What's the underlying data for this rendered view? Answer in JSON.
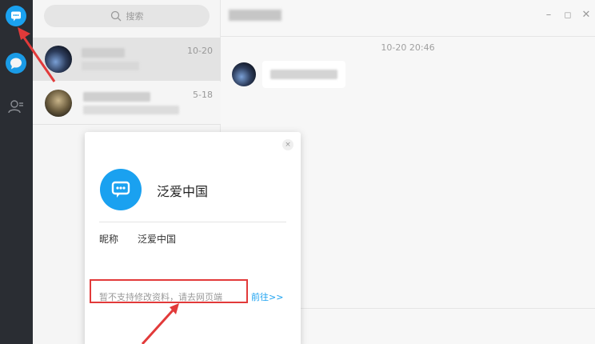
{
  "search": {
    "placeholder": "搜索"
  },
  "conversations": [
    {
      "time": "10-20"
    },
    {
      "time": "5-18"
    }
  ],
  "chat": {
    "timestamp": "10-20 20:46"
  },
  "window_controls": {
    "minimize": "–",
    "maximize": "◻",
    "close": "✕"
  },
  "profile_card": {
    "name": "泛爱中国",
    "nickname_label": "昵称",
    "nickname_value": "泛爱中国",
    "notice": "暂不支持修改资料，请去网页端",
    "link": "前往>>",
    "close": "×"
  },
  "colors": {
    "accent": "#1aa1f0",
    "rail": "#2a2d33",
    "annotation": "#e23a3a"
  },
  "icons": [
    "chat-bubble-icon",
    "message-icon",
    "contacts-icon",
    "search-icon"
  ]
}
